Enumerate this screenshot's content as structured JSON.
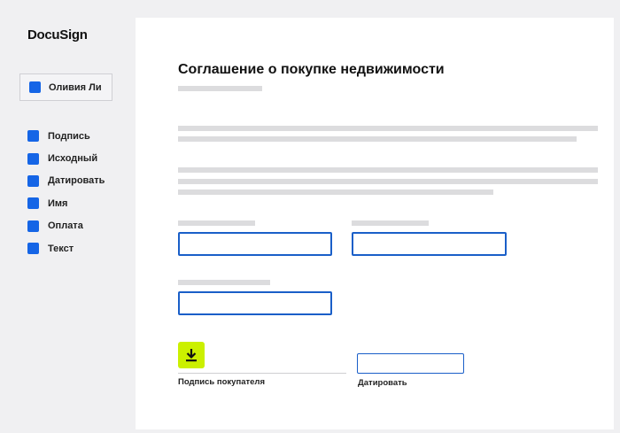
{
  "brand": {
    "logo": "DocuSign"
  },
  "recipient": {
    "name": "Оливия Ли",
    "color": "#1565e6"
  },
  "field_types": [
    {
      "label": "Подпись"
    },
    {
      "label": "Исходный"
    },
    {
      "label": "Датировать"
    },
    {
      "label": "Имя"
    },
    {
      "label": "Оплата"
    },
    {
      "label": "Текст"
    }
  ],
  "document": {
    "title": "Соглашение о покупке недвижимости",
    "signature_caption": "Подпись покупателя",
    "date_caption": "Датировать",
    "download_icon": "download-icon",
    "accent_colors": {
      "input_border": "#1a5fc8",
      "download_button": "#cbf000",
      "field_marker": "#1565e6"
    }
  }
}
